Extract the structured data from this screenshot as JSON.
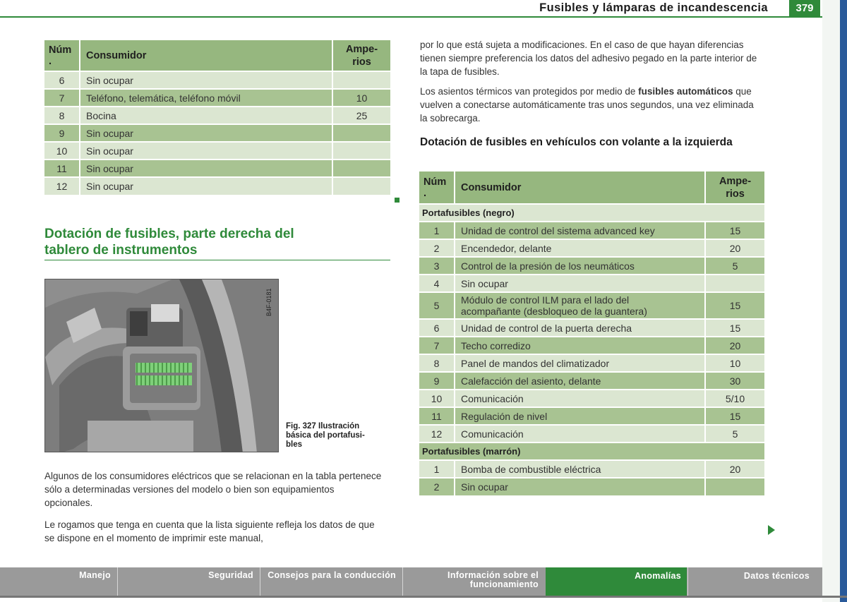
{
  "header": {
    "title": "Fusibles y lámparas de incandescencia",
    "page_number": "379"
  },
  "table_left": {
    "headers": {
      "num": "Núm\n.",
      "consumer": "Consumidor",
      "amp_line1": "Ampe-",
      "amp_line2": "rios"
    },
    "rows": [
      {
        "num": "6",
        "consumer": "Sin ocupar",
        "amp": ""
      },
      {
        "num": "7",
        "consumer": "Teléfono, telemática, teléfono móvil",
        "amp": "10"
      },
      {
        "num": "8",
        "consumer": "Bocina",
        "amp": "25"
      },
      {
        "num": "9",
        "consumer": "Sin ocupar",
        "amp": ""
      },
      {
        "num": "10",
        "consumer": "Sin ocupar",
        "amp": ""
      },
      {
        "num": "11",
        "consumer": "Sin ocupar",
        "amp": ""
      },
      {
        "num": "12",
        "consumer": "Sin ocupar",
        "amp": ""
      }
    ]
  },
  "section_heading": {
    "line1": "Dotación de fusibles, parte derecha del",
    "line2": "tablero de instrumentos"
  },
  "figure": {
    "code": "B4F-0181",
    "caption_line1": "Fig. 327  Ilustración",
    "caption_line2": "básica del portafusi-",
    "caption_line3": "bles"
  },
  "left_paragraphs": [
    "Algunos de los consumidores eléctricos que se relacionan en la tabla pertenece sólo a determinadas versiones del modelo o bien son equipamientos opcionales.",
    "Le rogamos que tenga en cuenta que la lista siguiente refleja los datos de que se dispone en el momento de imprimir este manual,"
  ],
  "right_paragraphs": {
    "p1": "por lo que está sujeta a modificaciones. En el caso de que hayan diferencias tienen siempre preferencia los datos del adhesivo pegado en la parte interior de la tapa de fusibles.",
    "p2_before": "Los asientos térmicos van protegidos por medio de ",
    "p2_bold": "fusibles automáticos",
    "p2_after": " que vuelven a conectarse automáticamente tras unos segundos, una vez eliminada la sobrecarga."
  },
  "subheading": "Dotación de fusibles en vehículos con volante a la izquierda",
  "table_right": {
    "headers": {
      "num": "Núm\n.",
      "consumer": "Consumidor",
      "amp_line1": "Ampe-",
      "amp_line2": "rios"
    },
    "section_black": "Portafusibles (negro)",
    "rows_black": [
      {
        "num": "1",
        "consumer": "Unidad de control del sistema advanced key",
        "amp": "15"
      },
      {
        "num": "2",
        "consumer": "Encendedor, delante",
        "amp": "20"
      },
      {
        "num": "3",
        "consumer": "Control de la presión de los neumáticos",
        "amp": "5"
      },
      {
        "num": "4",
        "consumer": "Sin ocupar",
        "amp": ""
      },
      {
        "num": "5",
        "consumer": "Módulo de control ILM para el lado del acompañante (desbloqueo de la guantera)",
        "amp": "15"
      },
      {
        "num": "6",
        "consumer": "Unidad de control de la puerta derecha",
        "amp": "15"
      },
      {
        "num": "7",
        "consumer": "Techo corredizo",
        "amp": "20"
      },
      {
        "num": "8",
        "consumer": "Panel de mandos del climatizador",
        "amp": "10"
      },
      {
        "num": "9",
        "consumer": "Calefacción del asiento, delante",
        "amp": "30"
      },
      {
        "num": "10",
        "consumer": "Comunicación",
        "amp": "5/10"
      },
      {
        "num": "11",
        "consumer": "Regulación de nivel",
        "amp": "15"
      },
      {
        "num": "12",
        "consumer": "Comunicación",
        "amp": "5"
      }
    ],
    "section_brown": "Portafusibles (marrón)",
    "rows_brown": [
      {
        "num": "1",
        "consumer": "Bomba de combustible eléctrica",
        "amp": "20"
      },
      {
        "num": "2",
        "consumer": "Sin ocupar",
        "amp": ""
      }
    ]
  },
  "footer": {
    "tabs": [
      {
        "label": "Manejo"
      },
      {
        "label": "Seguridad"
      },
      {
        "label": "Consejos para la conducción"
      },
      {
        "label": "Información sobre el funcionamiento"
      },
      {
        "label": "Anomalías"
      },
      {
        "label": "Datos técnicos"
      }
    ]
  },
  "colors": {
    "accent": "#2f8a3a",
    "header_row": "#96b77f",
    "row_dark": "#a8c392",
    "row_light": "#dbe6d1"
  }
}
